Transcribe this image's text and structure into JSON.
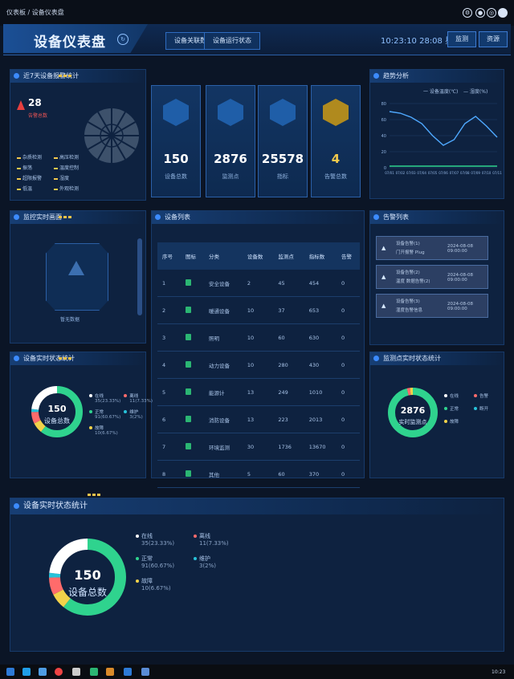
{
  "window": {
    "breadcrumb": "仪表板 / 设备仪表盘",
    "controls": [
      "gear-icon",
      "bell-icon",
      "settings-icon",
      "user-icon"
    ]
  },
  "header": {
    "title": "设备仪表盘",
    "tabs": [
      "设备关联数",
      "设备运行状态"
    ],
    "time": "10:23:10 28:08 星期四",
    "buttons": [
      "监测",
      "资源"
    ]
  },
  "alarm_panel": {
    "title": "近7天设备报警统计",
    "count": "28",
    "count_label": "告警总数",
    "legend": [
      "杂质检测",
      "高压检测",
      "振荡",
      "温度控制",
      "超限报警",
      "湿度",
      "低温",
      "外观检测"
    ]
  },
  "stats": [
    {
      "value": "150",
      "label": "设备总数",
      "icon": "device-icon",
      "color": "#1f5ea8"
    },
    {
      "value": "2876",
      "label": "监测点",
      "icon": "camera-icon",
      "color": "#1f5ea8"
    },
    {
      "value": "25578",
      "label": "指标",
      "icon": "chart-icon",
      "color": "#1f5ea8"
    },
    {
      "value": "4",
      "label": "告警总数",
      "icon": "warning-icon",
      "color": "#b08a1e"
    }
  ],
  "line_panel": {
    "title": "趋势分析",
    "legend": [
      "一 设备温度(℃)",
      "— 湿度(%)"
    ],
    "y_ticks": [
      "80",
      "60",
      "40",
      "20",
      "0"
    ],
    "x_ticks": [
      "07/01",
      "07/02",
      "07/03",
      "07/04",
      "07/05",
      "07/06",
      "07/07",
      "07/08",
      "07/09",
      "07/10",
      "07/11"
    ]
  },
  "chart_data": {
    "type": "line",
    "x": [
      "07/01",
      "07/02",
      "07/03",
      "07/04",
      "07/05",
      "07/06",
      "07/07",
      "07/08",
      "07/09",
      "07/10",
      "07/11"
    ],
    "ylim": [
      0,
      80
    ],
    "series": [
      {
        "name": "设备温度(℃)",
        "values": [
          70,
          68,
          63,
          55,
          40,
          28,
          35,
          55,
          64,
          52,
          38
        ]
      },
      {
        "name": "湿度(%)",
        "values": [
          2,
          2,
          2,
          2,
          2,
          2,
          2,
          2,
          2,
          2,
          2
        ]
      }
    ]
  },
  "monitor_panel": {
    "title": "监控实时画面",
    "caption": "暂无数据"
  },
  "device_list": {
    "title": "设备列表",
    "columns": [
      "序号",
      "图标",
      "分类",
      "设备数",
      "监测点",
      "指标数",
      "告警"
    ],
    "rows": [
      [
        "1",
        "",
        "安全设备",
        "2",
        "45",
        "454",
        "0"
      ],
      [
        "2",
        "",
        "暖通设备",
        "10",
        "37",
        "653",
        "0"
      ],
      [
        "3",
        "",
        "照明",
        "10",
        "60",
        "630",
        "0"
      ],
      [
        "4",
        "",
        "动力设备",
        "10",
        "280",
        "430",
        "0"
      ],
      [
        "5",
        "",
        "能源计",
        "13",
        "249",
        "1010",
        "0"
      ],
      [
        "6",
        "",
        "消防设备",
        "13",
        "223",
        "2013",
        "0"
      ],
      [
        "7",
        "",
        "环境监测",
        "30",
        "1736",
        "13670",
        "0"
      ],
      [
        "8",
        "",
        "其他",
        "5",
        "60",
        "370",
        "0"
      ]
    ]
  },
  "alarm_list": {
    "title": "告警列表",
    "items": [
      {
        "line1": "设备告警(1)",
        "line2": "门开报警 Plug",
        "time": "2024-08-08 09:00:00"
      },
      {
        "line1": "设备告警(2)",
        "line2": "温度 数据告警(2)",
        "time": "2024-08-08 09:00:00"
      },
      {
        "line1": "设备告警(3)",
        "line2": "湿度告警信息",
        "time": "2024-08-08 09:00:00"
      }
    ]
  },
  "device_status": {
    "title": "设备实时状态统计",
    "total": "150",
    "total_label": "设备总数",
    "legend": [
      {
        "label": "在线",
        "value": "35(23.33%)",
        "color": "#ffffff"
      },
      {
        "label": "离线",
        "value": "11(7.33%)",
        "color": "#ff6b6b"
      },
      {
        "label": "正常",
        "value": "91(60.67%)",
        "color": "#2fd38e"
      },
      {
        "label": "维护",
        "value": "3(2%)",
        "color": "#27c2d9"
      },
      {
        "label": "故障",
        "value": "10(6.67%)",
        "color": "#f2d24a"
      }
    ],
    "segments": [
      0.6067,
      0.0667,
      0.0733,
      0.02,
      0.2333
    ]
  },
  "point_status": {
    "title": "监测点实时状态统计",
    "total": "2876",
    "total_label": "实时监测点",
    "legend": [
      {
        "label": "在线",
        "value": "",
        "color": "#ffffff"
      },
      {
        "label": "告警",
        "value": "",
        "color": "#ff6b6b"
      },
      {
        "label": "正常",
        "value": "",
        "color": "#2fd38e"
      },
      {
        "label": "断开",
        "value": "",
        "color": "#27c2d9"
      },
      {
        "label": "故障",
        "value": "",
        "color": "#f2d24a"
      }
    ],
    "segments": [
      0.96,
      0.02,
      0.02
    ]
  },
  "big_status": {
    "title": "设备实时状态统计",
    "total": "150",
    "total_label": "设备总数",
    "legend": [
      {
        "label": "在线",
        "value": "35(23.33%)",
        "color": "#ffffff"
      },
      {
        "label": "离线",
        "value": "11(7.33%)",
        "color": "#ff6b6b"
      },
      {
        "label": "正常",
        "value": "91(60.67%)",
        "color": "#2fd38e"
      },
      {
        "label": "维护",
        "value": "3(2%)",
        "color": "#27c2d9"
      },
      {
        "label": "故障",
        "value": "10(6.67%)",
        "color": "#f2d24a"
      }
    ]
  },
  "taskbar": {
    "time": "10:23"
  }
}
